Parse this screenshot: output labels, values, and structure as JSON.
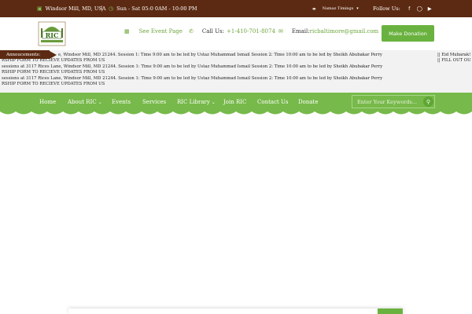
{
  "topbar": {
    "location": "Windsor Mill, MD, USA",
    "hours": "Sun - Sat 05:0 0AM - 10:00 PM",
    "namaz": "Namaz Timings",
    "follow": "Follow Us:",
    "social_icons": [
      "facebook-icon",
      "instagram-icon",
      "youtube-icon"
    ]
  },
  "header": {
    "logo_text": "RIC",
    "event_link": "See Event Page",
    "call_label": "Call Us:",
    "call_number": "+1-410-701-8074",
    "email_label": "Email:",
    "email_value": "ricbaltimore@gmail.com",
    "donate": "Make Donation"
  },
  "ticker": {
    "label": "Annoucements:",
    "lines": [
      "e, Windsor Mill, MD 21244. Session 1: Time 9:00 am to be led by Ustaz Muhammad Ismail Session 2: Time 10:00 am to be led by Sheikh Abubakar Perry",
      "RSHIP FORM TO RECIEVE UPDATES FROM US",
      "sessions at 3117 Rices Lane, Windsor Mill, MD 21244. Session 1: Time 9:00 am to be led by Ustaz Muhammad Ismail Session 2: Time 10:00 am to be led by Sheikh Abubakar Perry",
      "RSHIP FORM TO RECIEVE UPDATES FROM US",
      "sessions at 3117 Rices Lane, Windsor Mill, MD 21244. Session 1: Time 9:00 am to be led by Ustaz Muhammad Ismail Session 2: Time 10:00 am to be led by Sheikh Abubakar Perry",
      "RSHIP FORM TO RECIEVE UPDATES FROM US"
    ],
    "right_1": "|| Eid Mubarak!",
    "right_2": "|| FILL OUT OU"
  },
  "nav": {
    "items": [
      {
        "label": "Home"
      },
      {
        "label": "About RIC"
      },
      {
        "label": "Events"
      },
      {
        "label": "Services"
      },
      {
        "label": "RIC Library"
      },
      {
        "label": "Join RIC"
      },
      {
        "label": "Contact Us"
      },
      {
        "label": "Donate"
      }
    ],
    "search_placeholder": "Enter Your Keywords..."
  },
  "colors": {
    "brown": "#5c2a12",
    "green": "#77b94a",
    "accent_green": "#6ab23f"
  }
}
